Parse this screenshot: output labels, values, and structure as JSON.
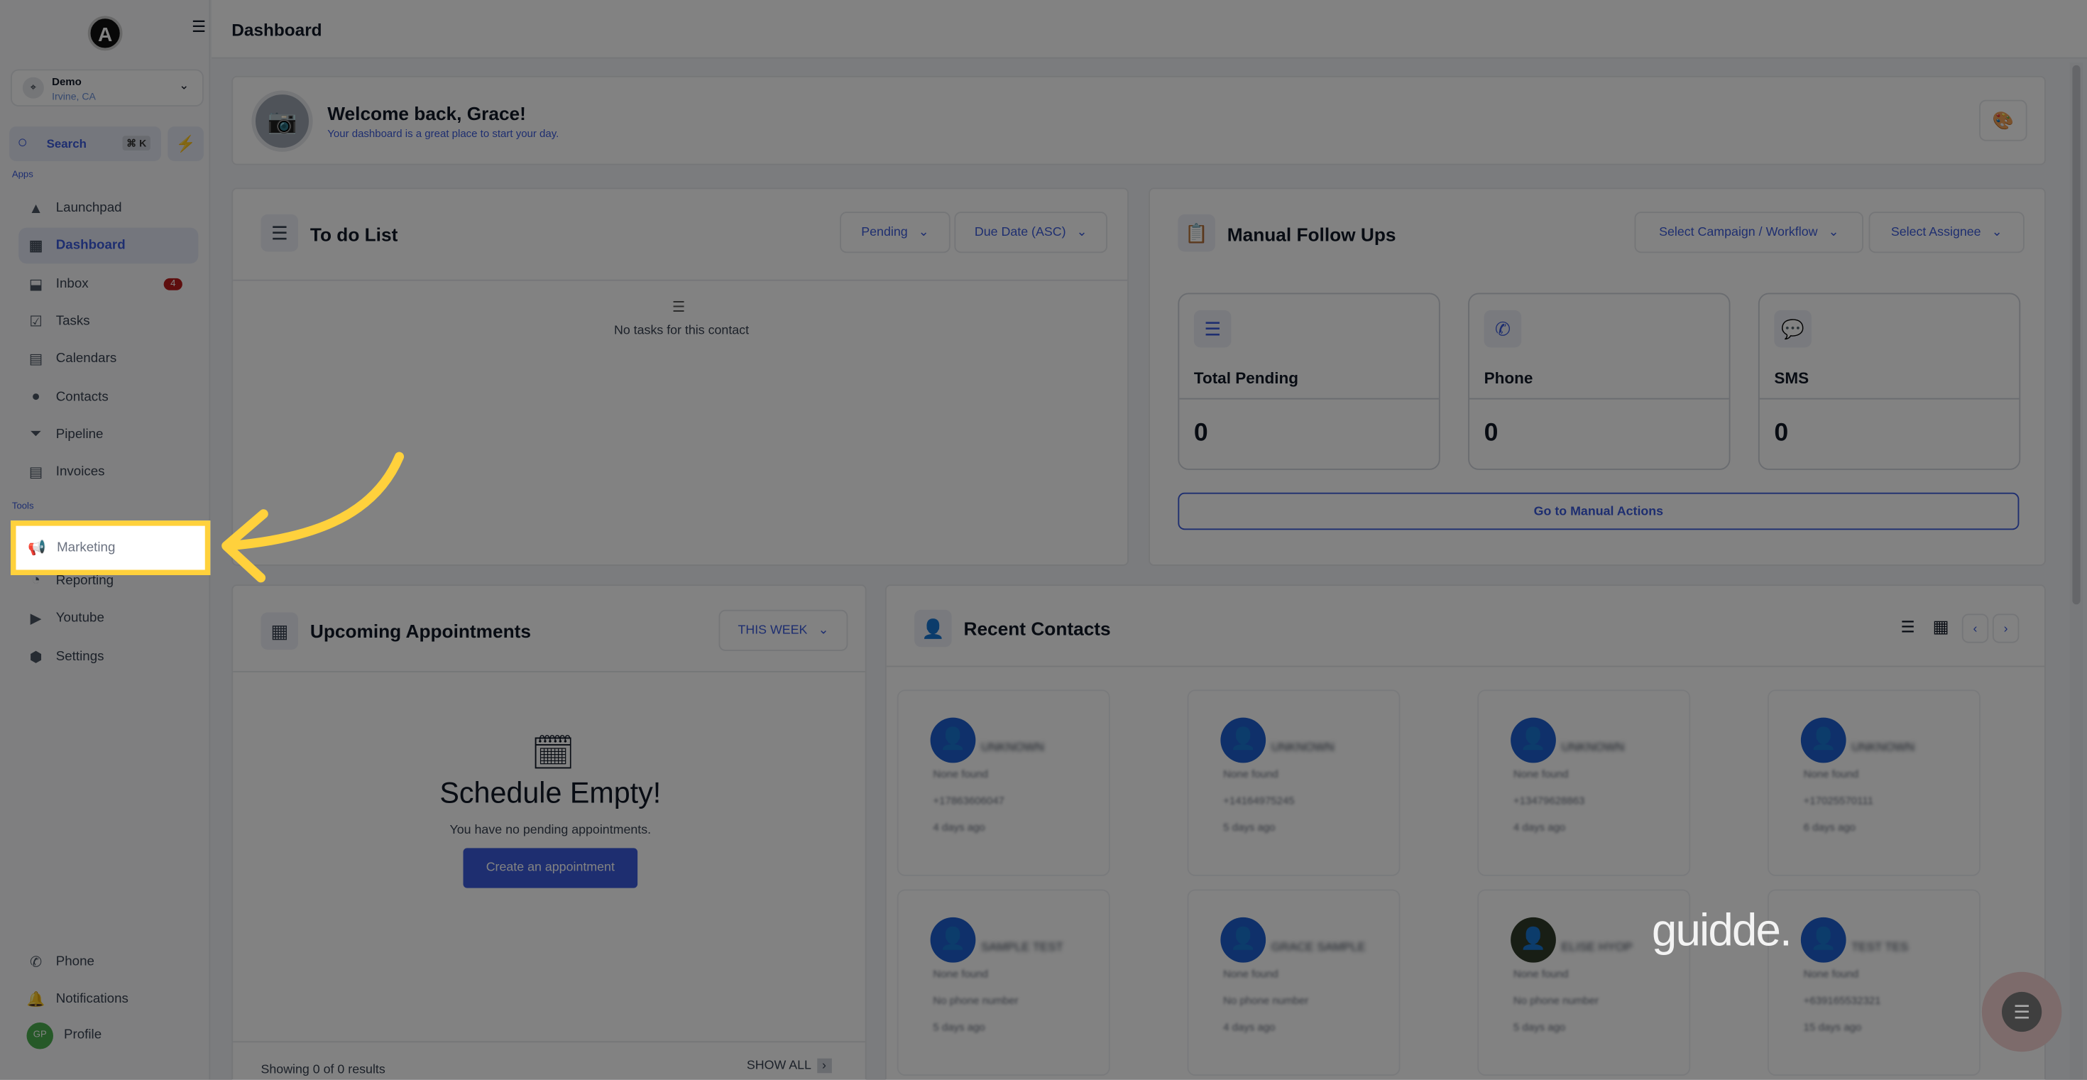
{
  "sidebar": {
    "logo": "A",
    "location": {
      "name": "Demo",
      "city": "Irvine, CA"
    },
    "search": {
      "label": "Search",
      "shortcut": "⌘ K"
    },
    "sections": {
      "apps": "Apps",
      "tools": "Tools"
    },
    "apps": [
      {
        "label": "Launchpad",
        "icon": "launchpad-icon",
        "glyph": "▲"
      },
      {
        "label": "Dashboard",
        "icon": "dashboard-icon",
        "glyph": "▦",
        "active": true
      },
      {
        "label": "Inbox",
        "icon": "inbox-icon",
        "glyph": "⬓",
        "badge": "4"
      },
      {
        "label": "Tasks",
        "icon": "tasks-icon",
        "glyph": "☑"
      },
      {
        "label": "Calendars",
        "icon": "calendar-icon",
        "glyph": "▤"
      },
      {
        "label": "Contacts",
        "icon": "contacts-icon",
        "glyph": "●"
      },
      {
        "label": "Pipeline",
        "icon": "pipeline-icon",
        "glyph": "⏷"
      },
      {
        "label": "Invoices",
        "icon": "invoice-icon",
        "glyph": "▤"
      }
    ],
    "tools": [
      {
        "label": "Marketing",
        "icon": "megaphone-icon",
        "glyph": "📢"
      },
      {
        "label": "Reporting",
        "icon": "reporting-icon",
        "glyph": "◔"
      },
      {
        "label": "Youtube",
        "icon": "youtube-icon",
        "glyph": "▶"
      },
      {
        "label": "Settings",
        "icon": "settings-icon",
        "glyph": "⬢"
      }
    ],
    "bottom": [
      {
        "label": "Phone",
        "glyph": "✆"
      },
      {
        "label": "Notifications",
        "glyph": "🔔"
      },
      {
        "label": "Profile",
        "glyph": "GP"
      }
    ]
  },
  "header": {
    "title": "Dashboard"
  },
  "welcome": {
    "title": "Welcome back, Grace!",
    "subtitle": "Your dashboard is a great place to start your day."
  },
  "todo": {
    "title": "To do List",
    "filter_status": "Pending",
    "filter_sort": "Due Date (ASC)",
    "empty": "No tasks for this contact"
  },
  "followups": {
    "title": "Manual Follow Ups",
    "campaign": "Select Campaign / Workflow",
    "assignee": "Select Assignee",
    "stats": [
      {
        "label": "Total Pending",
        "value": "0",
        "glyph": "☰"
      },
      {
        "label": "Phone",
        "value": "0",
        "glyph": "✆"
      },
      {
        "label": "SMS",
        "value": "0",
        "glyph": "💬"
      }
    ],
    "action": "Go to Manual Actions"
  },
  "appointments": {
    "title": "Upcoming Appointments",
    "range": "THIS WEEK",
    "empty_title": "Schedule Empty!",
    "empty_text": "You have no pending appointments.",
    "create": "Create an appointment",
    "footer": "Showing 0 of 0 results",
    "show_all": "SHOW ALL"
  },
  "contacts": {
    "title": "Recent Contacts",
    "items": [
      {
        "name": "UNKNOWN",
        "email": "None found",
        "phone": "+17863606047",
        "time": "4 days ago"
      },
      {
        "name": "UNKNOWN",
        "email": "None found",
        "phone": "+14164975245",
        "time": "5 days ago"
      },
      {
        "name": "UNKNOWN",
        "email": "None found",
        "phone": "+13479628863",
        "time": "4 days ago"
      },
      {
        "name": "UNKNOWN",
        "email": "None found",
        "phone": "+17025570111",
        "time": "6 days ago"
      },
      {
        "name": "SAMPLE TEST",
        "email": "None found",
        "phone": "No phone number",
        "time": "5 days ago"
      },
      {
        "name": "GRACE SAMPLE",
        "email": "None found",
        "phone": "No phone number",
        "time": "4 days ago"
      },
      {
        "name": "ELISE HYOP",
        "email": "None found",
        "phone": "No phone number",
        "time": "5 days ago"
      },
      {
        "name": "TEST TES",
        "email": "None found",
        "phone": "+639165532321",
        "time": "15 days ago"
      }
    ]
  },
  "watermark": "guidde.",
  "colors": {
    "accent": "#3b5bdb",
    "highlight": "#ffd13c",
    "badge": "#b91c1c"
  }
}
